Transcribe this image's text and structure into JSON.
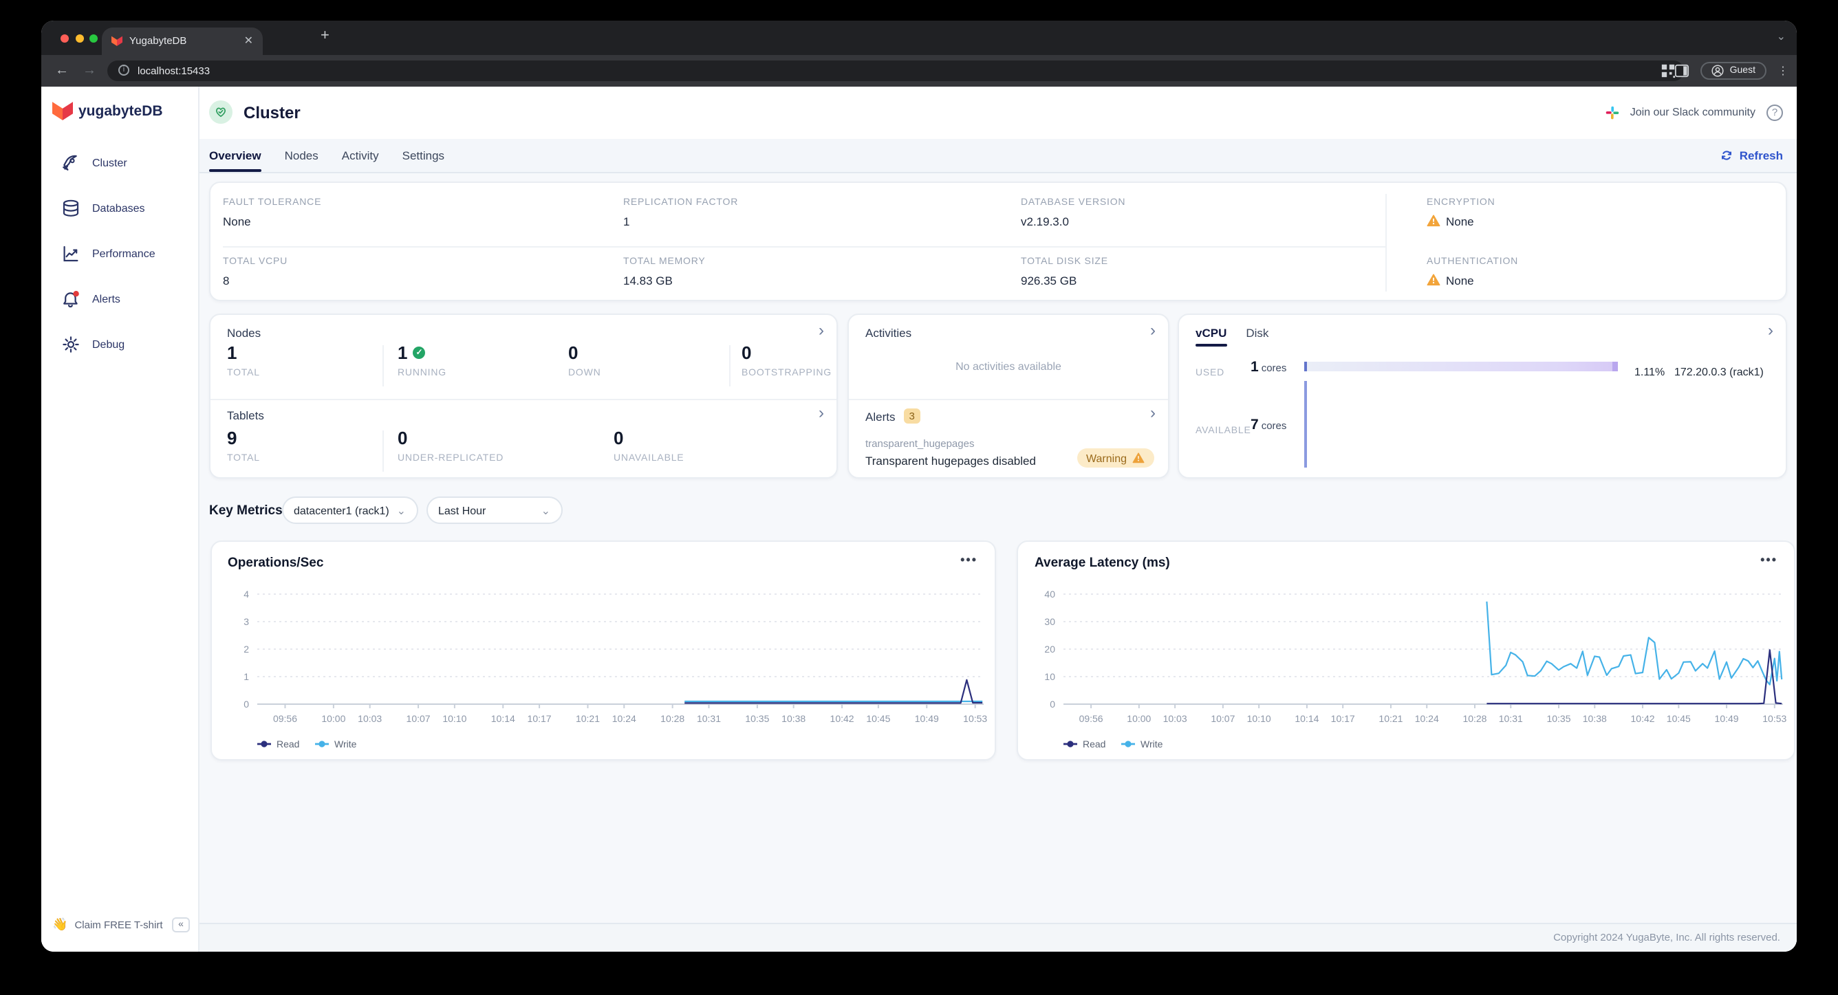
{
  "browser": {
    "tab_title": "YugabyteDB",
    "url": "localhost:15433",
    "profile": "Guest",
    "new_tab": "+",
    "close_tab": "✕"
  },
  "sidebar": {
    "logo": "yugabyteDB",
    "items": [
      {
        "label": "Cluster"
      },
      {
        "label": "Databases"
      },
      {
        "label": "Performance"
      },
      {
        "label": "Alerts"
      },
      {
        "label": "Debug"
      }
    ],
    "tshirt": "Claim FREE T-shirt",
    "collapse": "«"
  },
  "header": {
    "title": "Cluster",
    "slack": "Join our Slack community",
    "help": "?"
  },
  "tabs": [
    {
      "label": "Overview"
    },
    {
      "label": "Nodes"
    },
    {
      "label": "Activity"
    },
    {
      "label": "Settings"
    }
  ],
  "refresh_label": "Refresh",
  "overview": {
    "fault_tolerance": {
      "label": "FAULT TOLERANCE",
      "value": "None"
    },
    "replication_factor": {
      "label": "REPLICATION FACTOR",
      "value": "1"
    },
    "database_version": {
      "label": "DATABASE VERSION",
      "value": "v2.19.3.0"
    },
    "encryption": {
      "label": "ENCRYPTION",
      "value": "None"
    },
    "total_vcpu": {
      "label": "TOTAL VCPU",
      "value": "8"
    },
    "total_memory": {
      "label": "TOTAL MEMORY",
      "value": "14.83 GB"
    },
    "total_disk": {
      "label": "TOTAL DISK SIZE",
      "value": "926.35 GB"
    },
    "authentication": {
      "label": "AUTHENTICATION",
      "value": "None"
    }
  },
  "nodes_panel": {
    "title": "Nodes",
    "stats": [
      {
        "value": "1",
        "label": "TOTAL"
      },
      {
        "value": "1",
        "label": "RUNNING"
      },
      {
        "value": "0",
        "label": "DOWN"
      },
      {
        "value": "0",
        "label": "BOOTSTRAPPING"
      }
    ]
  },
  "tablets_panel": {
    "title": "Tablets",
    "stats": [
      {
        "value": "9",
        "label": "TOTAL"
      },
      {
        "value": "0",
        "label": "UNDER-REPLICATED"
      },
      {
        "value": "0",
        "label": "UNAVAILABLE"
      }
    ]
  },
  "activities_panel": {
    "title": "Activities",
    "empty": "No activities available"
  },
  "alerts_panel": {
    "title": "Alerts",
    "count": "3",
    "alert_name": "transparent_hugepages",
    "alert_text": "Transparent hugepages disabled",
    "badge": "Warning"
  },
  "cpu_panel": {
    "tabs": [
      {
        "label": "vCPU"
      },
      {
        "label": "Disk"
      }
    ],
    "used_label": "USED",
    "used_value": "1",
    "used_unit": "cores",
    "used_pct": "1.11%",
    "used_node": "172.20.0.3 (rack1)",
    "avail_label": "AVAILABLE",
    "avail_value": "7",
    "avail_unit": "cores"
  },
  "key_metrics": {
    "title": "Key Metrics",
    "region": "datacenter1 (rack1)",
    "range": "Last Hour"
  },
  "colors": {
    "accent_blue": "#2f54cc",
    "warning": "#f2a43a",
    "success": "#23a566",
    "read_line": "#2b2f7d",
    "write_line": "#45b2e8"
  },
  "chart_data": [
    {
      "id": "ops",
      "type": "line",
      "title": "Operations/Sec",
      "ylim": [
        0,
        4
      ],
      "yticks": [
        0,
        1,
        2,
        3,
        4
      ],
      "xmin": -2.3,
      "xmax": 57.7,
      "x_tick_minutes": [
        0,
        4,
        7,
        11,
        14,
        18,
        21,
        25,
        28,
        32,
        35,
        39,
        42,
        46,
        49,
        53,
        57
      ],
      "x_tick_labels": [
        "09:56",
        "10:00",
        "10:03",
        "10:07",
        "10:10",
        "10:14",
        "10:17",
        "10:21",
        "10:24",
        "10:28",
        "10:31",
        "10:35",
        "10:38",
        "10:42",
        "10:45",
        "10:49",
        "10:53"
      ],
      "grid": true,
      "legend_position": "bottom-left",
      "series": [
        {
          "name": "Read",
          "color": "#2b2f7d",
          "points": [
            [
              33,
              0.04
            ],
            [
              55.8,
              0.04
            ],
            [
              56.3,
              0.88
            ],
            [
              56.8,
              0.05
            ],
            [
              57.6,
              0.05
            ]
          ]
        },
        {
          "name": "Write",
          "color": "#45b2e8",
          "points": [
            [
              33,
              0.1
            ],
            [
              57.6,
              0.1
            ]
          ]
        }
      ]
    },
    {
      "id": "lat",
      "type": "line",
      "title": "Average Latency (ms)",
      "ylim": [
        0,
        40
      ],
      "yticks": [
        0,
        10,
        20,
        30,
        40
      ],
      "xmin": -2.3,
      "xmax": 57.7,
      "x_tick_minutes": [
        0,
        4,
        7,
        11,
        14,
        18,
        21,
        25,
        28,
        32,
        35,
        39,
        42,
        46,
        49,
        53,
        57
      ],
      "x_tick_labels": [
        "09:56",
        "10:00",
        "10:03",
        "10:07",
        "10:10",
        "10:14",
        "10:17",
        "10:21",
        "10:24",
        "10:28",
        "10:31",
        "10:35",
        "10:38",
        "10:42",
        "10:45",
        "10:49",
        "10:53"
      ],
      "grid": true,
      "legend_position": "bottom-left",
      "series": [
        {
          "name": "Read",
          "color": "#2b2f7d",
          "points": [
            [
              33,
              0.2
            ],
            [
              55.6,
              0.2
            ],
            [
              56.1,
              0.3
            ],
            [
              56.6,
              19.7
            ],
            [
              57.1,
              0.4
            ],
            [
              57.6,
              0.2
            ]
          ]
        },
        {
          "name": "Write",
          "color": "#45b2e8",
          "points": [
            [
              33,
              37.3
            ],
            [
              33.4,
              10.7
            ],
            [
              34,
              11.2
            ],
            [
              34.6,
              14.1
            ],
            [
              35,
              18.8
            ],
            [
              35.4,
              17.9
            ],
            [
              36,
              15.4
            ],
            [
              36.4,
              10.4
            ],
            [
              37,
              10.2
            ],
            [
              37.5,
              12.1
            ],
            [
              38,
              15.6
            ],
            [
              38.4,
              14.7
            ],
            [
              39,
              12.4
            ],
            [
              39.4,
              13.6
            ],
            [
              40,
              14.7
            ],
            [
              40.5,
              13.1
            ],
            [
              41,
              19.2
            ],
            [
              41.4,
              10.5
            ],
            [
              42,
              17.4
            ],
            [
              42.4,
              17.1
            ],
            [
              43,
              10.5
            ],
            [
              43.4,
              12.9
            ],
            [
              44,
              13.7
            ],
            [
              44.4,
              17.5
            ],
            [
              45,
              17.9
            ],
            [
              45.4,
              11.1
            ],
            [
              46,
              11.5
            ],
            [
              46.5,
              24.2
            ],
            [
              47,
              22.4
            ],
            [
              47.4,
              9.1
            ],
            [
              48,
              12.5
            ],
            [
              48.4,
              9.2
            ],
            [
              49,
              11.3
            ],
            [
              49.4,
              15.3
            ],
            [
              50,
              15.4
            ],
            [
              50.4,
              12.1
            ],
            [
              51,
              14.7
            ],
            [
              51.4,
              13.1
            ],
            [
              52,
              19.3
            ],
            [
              52.4,
              9.1
            ],
            [
              53,
              15.3
            ],
            [
              53.4,
              9.5
            ],
            [
              54,
              13.3
            ],
            [
              54.4,
              16.5
            ],
            [
              54.8,
              15.7
            ],
            [
              55.2,
              13.3
            ],
            [
              55.6,
              15.7
            ],
            [
              56,
              11.6
            ],
            [
              56.3,
              8.7
            ],
            [
              56.6,
              7.1
            ],
            [
              57,
              16.6
            ],
            [
              57.2,
              8.5
            ],
            [
              57.4,
              19.1
            ],
            [
              57.6,
              9.0
            ]
          ]
        }
      ]
    }
  ],
  "footer": {
    "copyright": "Copyright 2024 YugaByte, Inc. All rights reserved."
  }
}
